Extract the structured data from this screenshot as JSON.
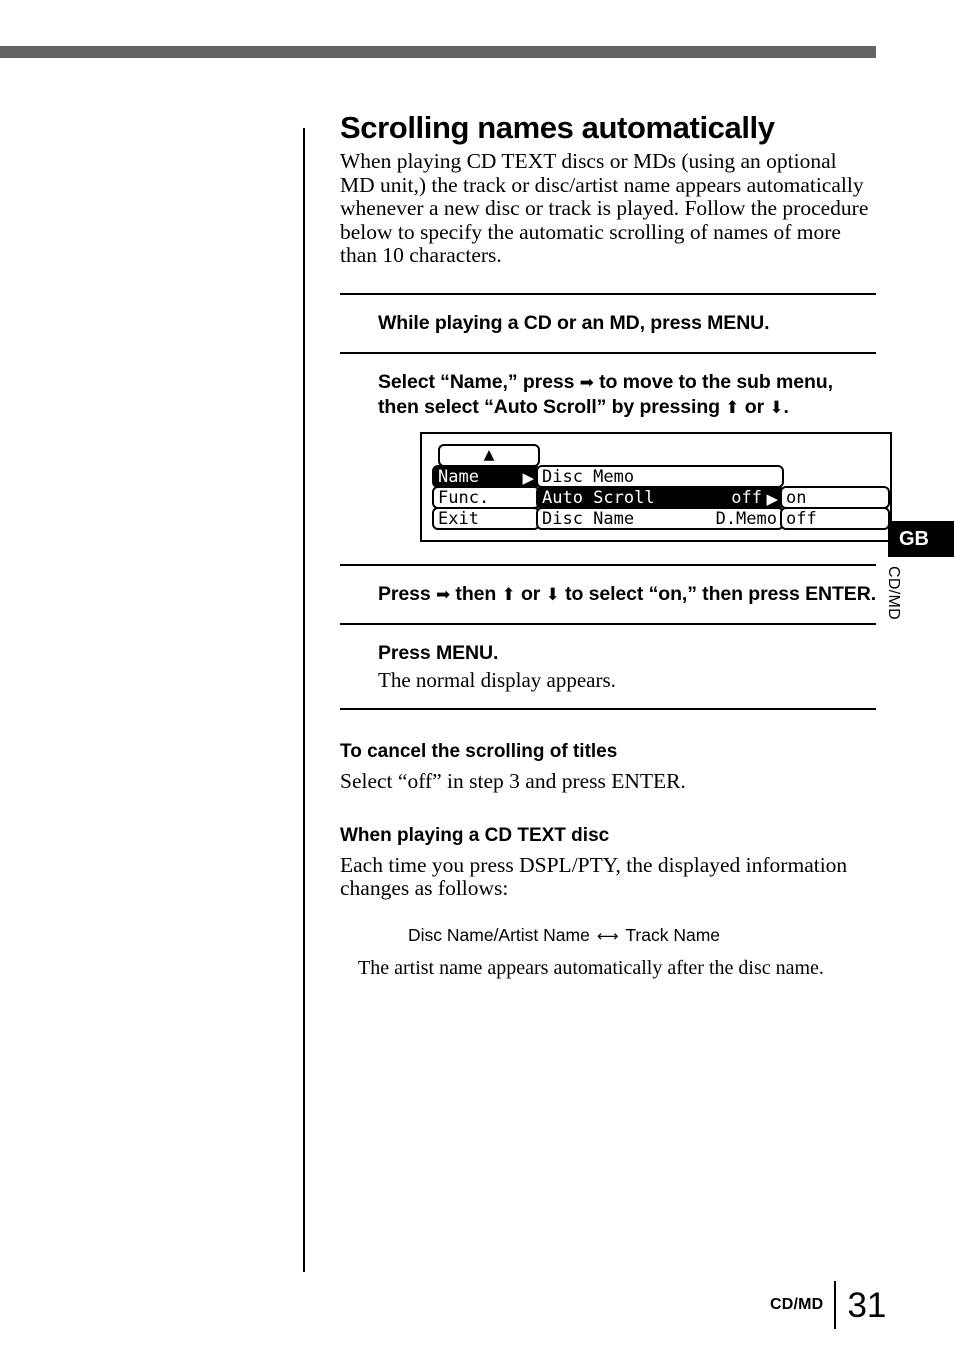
{
  "page": {
    "title": "Scrolling names automatically",
    "intro": "When playing CD TEXT discs or MDs (using an optional MD unit,) the track or disc/artist name appears automatically whenever a new disc or track is played. Follow the procedure below to specify the automatic scrolling of names of more than 10 characters."
  },
  "steps": [
    {
      "text_before": "While playing a CD or an MD, press MENU."
    },
    {
      "part1": "Select “Name,” press ",
      "arrow_right": "➡",
      "part2": " to move to the sub menu, then select “Auto Scroll” by pressing ",
      "arrow_up": "⬆",
      "part3": " or ",
      "arrow_down": "⬇",
      "part4": "."
    },
    {
      "part1": "Press ",
      "arrow_right": "➡",
      "part2": " then ",
      "arrow_up": "⬆",
      "part3": " or ",
      "arrow_down": "⬇",
      "part4": " to select “on,” then press ENTER."
    },
    {
      "text_before": "Press MENU.",
      "note": "The normal display appears."
    }
  ],
  "lcd": {
    "scroll_up_glyph": "▲",
    "left_column": [
      {
        "label": "Name",
        "selected": true,
        "arrow": "▶"
      },
      {
        "label": "Func.",
        "selected": false,
        "arrow": ""
      },
      {
        "label": "Exit",
        "selected": false,
        "arrow": ""
      }
    ],
    "middle_column": [
      {
        "label": "Disc Memo",
        "value": "",
        "selected": false,
        "arrow": ""
      },
      {
        "label": "Auto Scroll",
        "value": "off",
        "selected": true,
        "arrow": "▶"
      },
      {
        "label": "Disc Name",
        "value": "D.Memo",
        "selected": false,
        "arrow": ""
      }
    ],
    "right_column": [
      {
        "label": "on",
        "selected": false
      },
      {
        "label": "off",
        "selected": false
      }
    ]
  },
  "sections": [
    {
      "heading": "To cancel the scrolling of titles",
      "body": "Select “off” in step 3 and press ENTER."
    },
    {
      "heading": "When playing a CD TEXT disc",
      "body": "Each time you press DSPL/PTY, the displayed information changes as follows:",
      "flow_left": "Disc Name/Artist Name",
      "flow_arrow": "⟷",
      "flow_right": "Track Name",
      "flow_note": "The artist name appears automatically after the disc name."
    }
  ],
  "margin": {
    "tab_label": "GB",
    "side_label": "CD/MD"
  },
  "footer": {
    "label": "CD/MD",
    "page_number": "31"
  }
}
